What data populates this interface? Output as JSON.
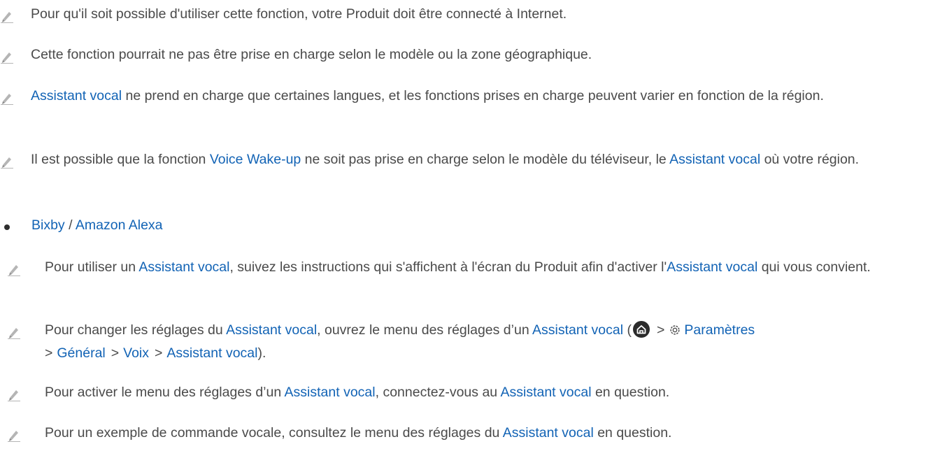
{
  "notes": [
    {
      "text": "Pour qu'il soit possible d'utiliser cette fonction, votre Produit doit être connecté à Internet."
    },
    {
      "text": "Cette fonction pourrait ne pas être prise en charge selon le modèle ou la zone géographique."
    },
    {
      "link": "Assistant vocal",
      "rest": " ne prend en charge que certaines langues, et les fonctions prises en charge peuvent varier en fonction de la région."
    },
    {
      "pre": "Il est possible que la fonction ",
      "link1": "Voice Wake-up",
      "mid": " ne soit pas prise en charge selon le modèle du téléviseur, le ",
      "link2": "Assistant vocal",
      "post": " où votre région."
    }
  ],
  "bullet": {
    "item1": "Bixby",
    "sep": " / ",
    "item2": "Amazon Alexa"
  },
  "subnotes": {
    "n1": {
      "pre": "Pour utiliser un ",
      "link1": "Assistant vocal",
      "mid": ", suivez les instructions qui s'affichent à l'écran du Produit afin d'activer l'",
      "link2": "Assistant vocal",
      "post": " qui vous convient."
    },
    "n2": {
      "pre": "Pour changer les réglages du ",
      "link1": "Assistant vocal",
      "mid": ", ouvrez le menu des réglages d’un ",
      "link2": "Assistant vocal",
      "paren_open": " (",
      "path": [
        "Paramètres",
        "Général",
        "Voix",
        "Assistant vocal"
      ],
      "chevron": ">",
      "paren_close": ")."
    },
    "n3": {
      "pre": "Pour activer le menu des réglages d’un ",
      "link1": "Assistant vocal",
      "mid": ", connectez-vous au ",
      "link2": "Assistant vocal",
      "post": " en question."
    },
    "n4": {
      "pre": "Pour un exemple de commande vocale, consultez le menu des réglages du ",
      "link1": "Assistant vocal",
      "post": " en question."
    }
  },
  "colors": {
    "link": "#1263b5",
    "text": "#4a4a4a"
  },
  "icons": [
    "pencil-note-icon",
    "home-icon",
    "gear-icon",
    "bullet-dot"
  ]
}
